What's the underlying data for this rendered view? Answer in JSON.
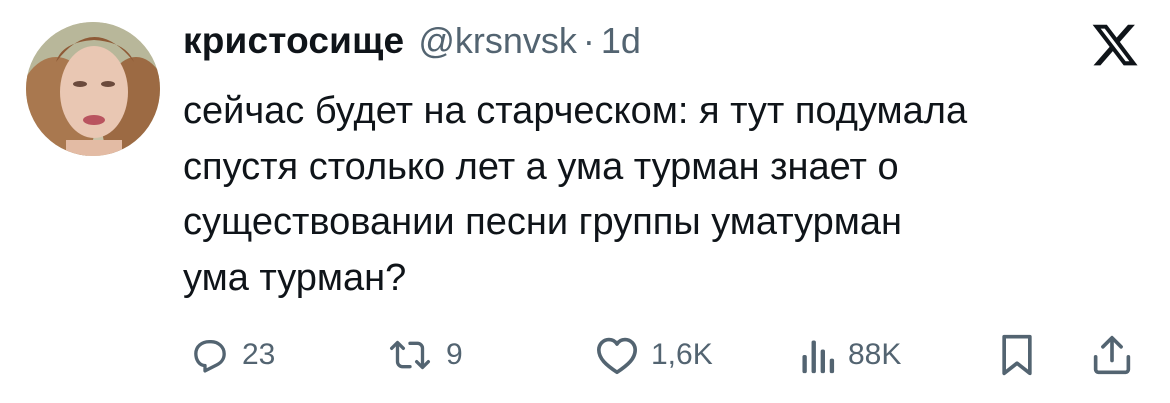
{
  "tweet": {
    "display_name": "кристосище",
    "handle": "@krsnvsk",
    "separator": "·",
    "time": "1d",
    "text": "сейчас будет на старческом: я тут подумала\nспустя столько лет а ума турман знает о\nсуществовании песни группы уматурман\nума турман?"
  },
  "actions": {
    "replies": "23",
    "reposts": "9",
    "likes": "1,6K",
    "views": "88K"
  },
  "icons": {
    "reply": "reply-icon",
    "repost": "repost-icon",
    "like": "heart-icon",
    "views": "views-icon",
    "bookmark": "bookmark-icon",
    "share": "share-icon",
    "brand": "x-logo-icon"
  },
  "colors": {
    "text_primary": "#0f1419",
    "text_secondary": "#536471"
  }
}
